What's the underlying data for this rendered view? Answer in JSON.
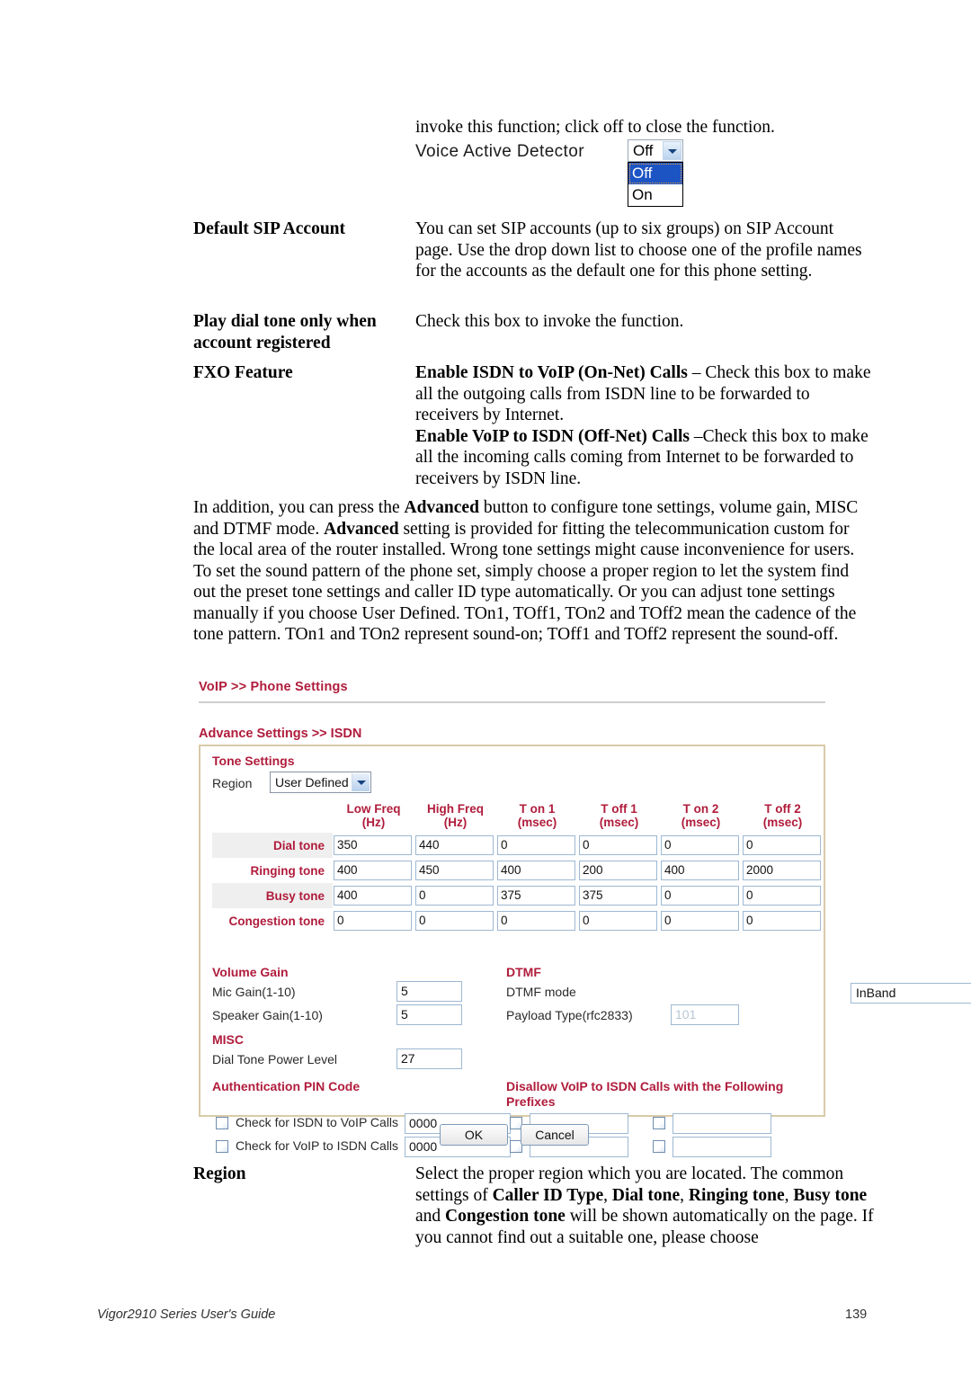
{
  "page": {
    "footer_left": "Vigor2910 Series User's Guide",
    "footer_right": "139"
  },
  "intro": {
    "line": "invoke this function; click off to close the function."
  },
  "vad": {
    "label": "Voice Active Detector",
    "value": "Off",
    "options": [
      "Off",
      "On"
    ]
  },
  "definitions": [
    {
      "term": "Default SIP Account",
      "desc": "You can set SIP accounts (up to six groups) on SIP Account page. Use the drop down list to choose one of the profile names for the accounts as the default one for this phone setting."
    },
    {
      "term": "Play dial tone only when account registered",
      "desc": "Check this box to invoke the function."
    }
  ],
  "fxo": {
    "term": "FXO Feature",
    "line1_bold": "Enable ISDN to VoIP (On-Net) Calls",
    "line1_rest": " – Check this box to make all the outgoing calls from ISDN line to be forwarded to receivers by Internet.",
    "line2_bold": "Enable VoIP to ISDN (Off-Net) Calls",
    "line2_rest": " –Check this box to make all the incoming calls coming from Internet to be forwarded to receivers by ISDN line."
  },
  "paragraph": {
    "p1": "In addition, you can press the ",
    "b1": "Advanced",
    "p2": " button to configure tone settings, volume gain, MISC and DTMF mode. ",
    "b2": "Advanced",
    "p3": " setting is provided for fitting the telecommunication custom for the local area of the router installed. Wrong tone settings might cause inconvenience for users. To set the sound pattern of the phone set, simply choose a proper region to let the system find out the preset tone settings and caller ID type automatically. Or you can adjust tone settings manually if you choose User Defined. TOn1, TOff1, TOn2 and TOff2 mean the cadence of the tone pattern. TOn1 and TOn2 represent sound-on; TOff1 and TOff2 represent the sound-off."
  },
  "router": {
    "breadcrumb": "VoIP >> Phone Settings",
    "section_head": "Advance Settings >> ISDN",
    "panel_title": "Tone Settings",
    "region": {
      "label": "Region",
      "value": "User Defined"
    },
    "tone_table": {
      "headers": [
        "",
        "Low Freq\n(Hz)",
        "High Freq\n(Hz)",
        "T on 1\n(msec)",
        "T off 1\n(msec)",
        "T on 2\n(msec)",
        "T off 2\n(msec)"
      ],
      "header_lines": [
        [
          "",
          ""
        ],
        [
          "Low Freq",
          "(Hz)"
        ],
        [
          "High Freq",
          "(Hz)"
        ],
        [
          "T on 1",
          "(msec)"
        ],
        [
          "T off 1",
          "(msec)"
        ],
        [
          "T on 2",
          "(msec)"
        ],
        [
          "T off 2",
          "(msec)"
        ]
      ],
      "rows": [
        {
          "label": "Dial tone",
          "values": [
            "350",
            "440",
            "0",
            "0",
            "0",
            "0"
          ]
        },
        {
          "label": "Ringing tone",
          "values": [
            "400",
            "450",
            "400",
            "200",
            "400",
            "2000"
          ]
        },
        {
          "label": "Busy tone",
          "values": [
            "400",
            "0",
            "375",
            "375",
            "0",
            "0"
          ]
        },
        {
          "label": "Congestion tone",
          "values": [
            "0",
            "0",
            "0",
            "0",
            "0",
            "0"
          ]
        }
      ]
    },
    "volume_gain": {
      "head": "Volume Gain",
      "mic_label": "Mic Gain(1-10)",
      "mic_value": "5",
      "speaker_label": "Speaker Gain(1-10)",
      "speaker_value": "5"
    },
    "misc": {
      "head": "MISC",
      "dial_tone_power_label": "Dial Tone Power Level",
      "dial_tone_power_value": "27"
    },
    "dtmf": {
      "head": "DTMF",
      "mode_label": "DTMF mode",
      "mode_value": "InBand",
      "payload_label": "Payload Type(rfc2833)",
      "payload_value": "101"
    },
    "pin": {
      "head": "Authentication PIN Code",
      "rows": [
        {
          "label": "Check for ISDN to VoIP Calls",
          "value": "0000",
          "checked": false
        },
        {
          "label": "Check for VoIP to ISDN Calls",
          "value": "0000",
          "checked": false
        }
      ]
    },
    "prefixes": {
      "head_line1": "Disallow VoIP to ISDN Calls with the Following",
      "head_line2": "Prefixes",
      "values": [
        "",
        "",
        "",
        ""
      ]
    },
    "buttons": {
      "ok": "OK",
      "cancel": "Cancel"
    }
  },
  "region_def": {
    "term": "Region",
    "p1": "Select the proper region which you are located. The common settings of ",
    "b1": "Caller ID Type",
    "p2": ", ",
    "b2": "Dial tone",
    "p3": ", ",
    "b3": "Ringing tone",
    "p4": ", ",
    "b4": "Busy tone",
    "p5": " and ",
    "b5": "Congestion tone",
    "p6": " will be shown automatically on the page. If you cannot find out a suitable one, please choose"
  },
  "colors": {
    "accent_red": "#b01c3c",
    "panel_border": "#d9cba8",
    "input_border": "#9db8d2"
  }
}
